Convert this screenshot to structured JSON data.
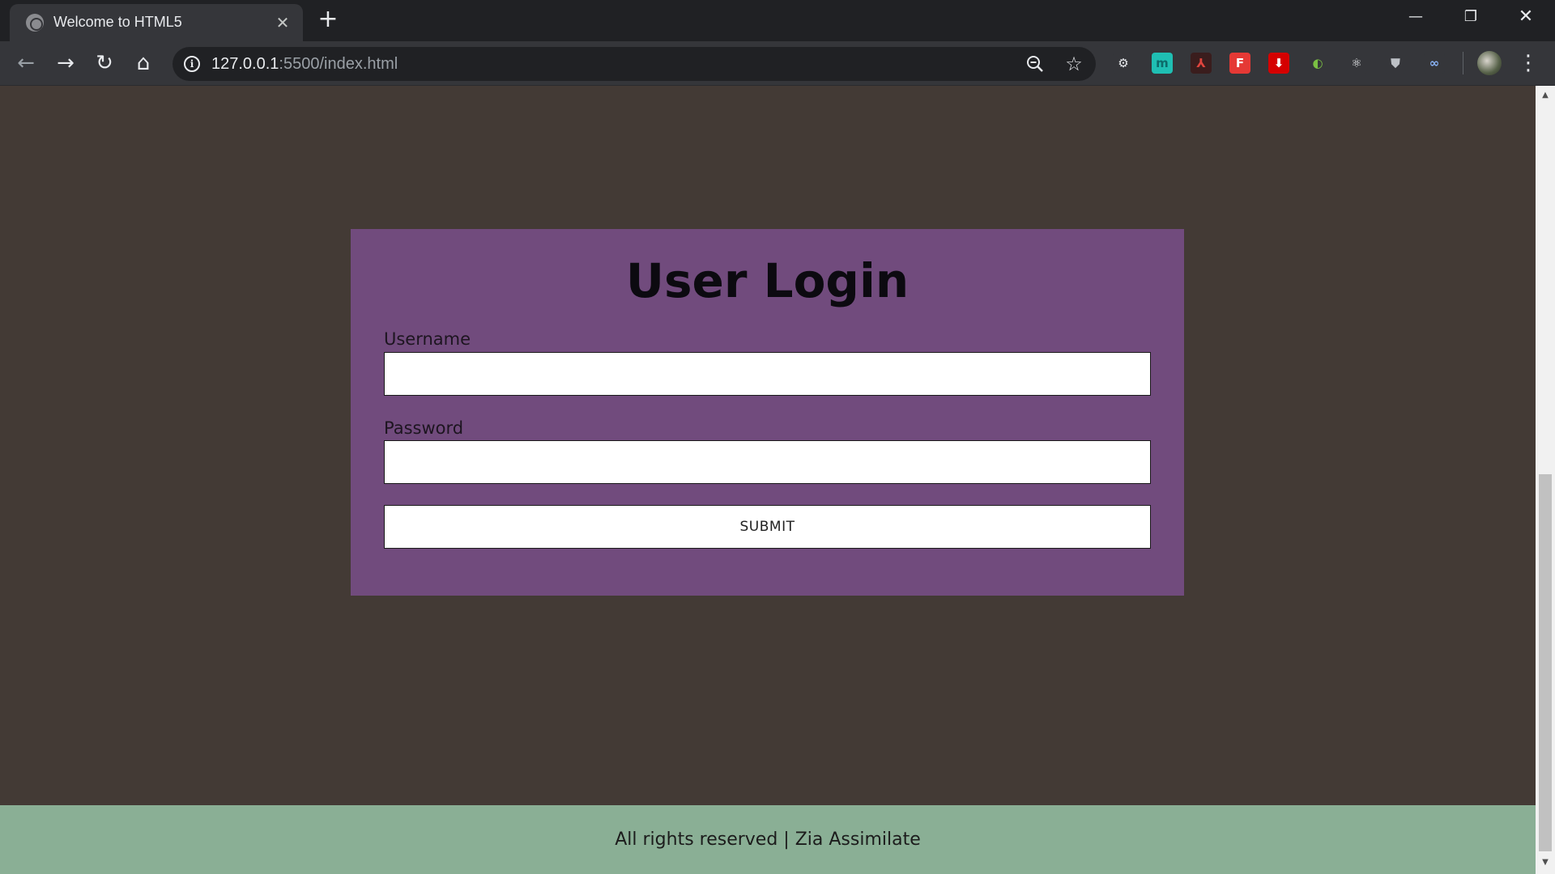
{
  "browser": {
    "tab": {
      "title": "Welcome to HTML5",
      "close": "✕"
    },
    "new_tab": "+",
    "window_controls": {
      "minimize": "—",
      "maximize": "❐",
      "close": "✕"
    },
    "nav": {
      "back": "←",
      "forward": "→",
      "reload": "↻",
      "home": "⌂"
    },
    "address": {
      "host": "127.0.0.1",
      "path": ":5500/index.html",
      "info": "i"
    },
    "omnibox_icons": [
      "zoom-out-icon",
      "bookmark-star-icon"
    ],
    "extensions": [
      {
        "name": "settings-gear-extension-icon",
        "glyph": "⚙",
        "color": "#35363a",
        "fg": "#e8eaed"
      },
      {
        "name": "m-extension-icon",
        "glyph": "m",
        "color": "#1fbfb3",
        "fg": "#0c6b6a"
      },
      {
        "name": "pdf-extension-icon",
        "glyph": "⅄",
        "color": "#3a1d1d",
        "fg": "#e0443d"
      },
      {
        "name": "f-extension-icon",
        "glyph": "F",
        "color": "#e53935",
        "fg": "#ffffff"
      },
      {
        "name": "download-extension-icon",
        "glyph": "⬇",
        "color": "#d50000",
        "fg": "#ffffff"
      },
      {
        "name": "color-wheel-extension-icon",
        "glyph": "◐",
        "color": "#35363a",
        "fg": "#7bc043"
      },
      {
        "name": "react-extension-icon",
        "glyph": "⚛",
        "color": "#35363a",
        "fg": "#e8eaed"
      },
      {
        "name": "shield-extension-icon",
        "glyph": "⛊",
        "color": "#35363a",
        "fg": "#bdc1c6"
      },
      {
        "name": "glasses-extension-icon",
        "glyph": "∞",
        "color": "#35363a",
        "fg": "#8ab4f8"
      }
    ],
    "menu": "⋮"
  },
  "page": {
    "login": {
      "title": "User Login",
      "username_label": "Username",
      "username_value": "",
      "password_label": "Password",
      "password_value": "",
      "submit_label": "SUBMIT"
    },
    "footer": {
      "text": "All rights reserved | Zia Assimilate"
    }
  },
  "colors": {
    "page_background": "#433a35",
    "card_background": "#714b7d",
    "footer_background": "#8aaf95"
  }
}
